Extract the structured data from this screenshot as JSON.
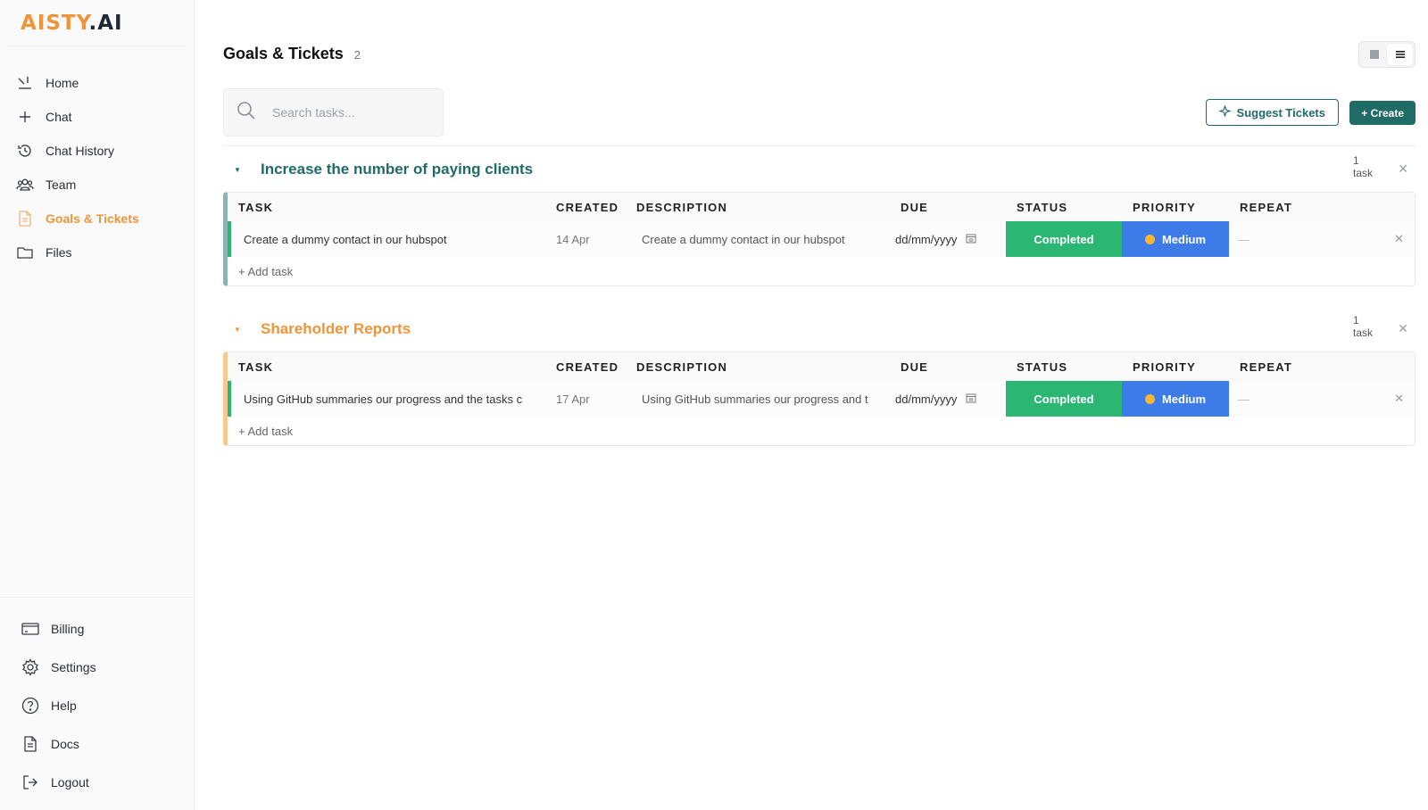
{
  "logo": {
    "a": "A",
    "isty": "ISTY",
    "ai": ".AI"
  },
  "sidebar": {
    "items": [
      {
        "label": "Home",
        "icon": "home-icon"
      },
      {
        "label": "Chat",
        "icon": "plus-icon"
      },
      {
        "label": "Chat History",
        "icon": "history-icon"
      },
      {
        "label": "Team",
        "icon": "team-icon"
      },
      {
        "label": "Goals & Tickets",
        "icon": "document-icon"
      },
      {
        "label": "Files",
        "icon": "folder-icon"
      }
    ],
    "bottom": [
      {
        "label": "Billing",
        "icon": "card-icon"
      },
      {
        "label": "Settings",
        "icon": "gear-icon"
      },
      {
        "label": "Help",
        "icon": "question-icon"
      },
      {
        "label": "Docs",
        "icon": "doc-icon"
      },
      {
        "label": "Logout",
        "icon": "logout-icon"
      }
    ]
  },
  "header": {
    "title": "Goals & Tickets",
    "count": "2"
  },
  "search": {
    "placeholder": "Search tasks..."
  },
  "actions": {
    "suggest": "Suggest Tickets",
    "create": "+ Create"
  },
  "columns": {
    "task": "TASK",
    "created": "CREATED",
    "description": "DESCRIPTION",
    "due": "DUE",
    "status": "STATUS",
    "priority": "PRIORITY",
    "repeat": "REPEAT"
  },
  "goals": [
    {
      "title": "Increase the number of paying clients",
      "color": "#1f6b66",
      "bar_color": "#8fb3b4",
      "count_num": "1",
      "count_label": "task",
      "task": {
        "name": "Create a dummy contact in our hubspot",
        "created": "14 Apr",
        "description": "Create a dummy contact in our hubspot",
        "due": "dd/mm/yyyy",
        "status": "Completed",
        "priority": "Medium",
        "repeat": "—"
      },
      "add": "+ Add task"
    },
    {
      "title": "Shareholder Reports",
      "color": "#f0943a",
      "bar_color": "#f5c992",
      "count_num": "1",
      "count_label": "task",
      "task": {
        "name": "Using GitHub summaries our progress and the tasks c",
        "created": "17 Apr",
        "description": "Using GitHub summaries our progress and t",
        "due": "dd/mm/yyyy",
        "status": "Completed",
        "priority": "Medium",
        "repeat": "—"
      },
      "add": "+ Add task"
    }
  ]
}
